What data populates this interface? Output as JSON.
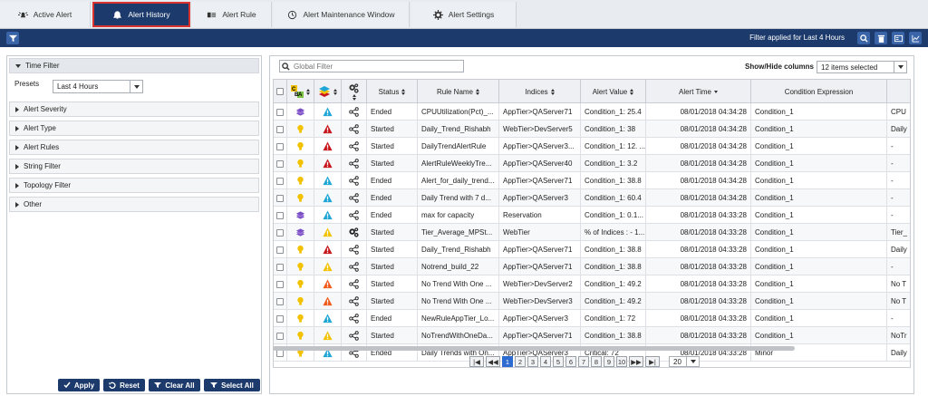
{
  "tabs": [
    {
      "label": "Active Alert",
      "icon": "alarm-icon"
    },
    {
      "label": "Alert History",
      "icon": "bell-icon"
    },
    {
      "label": "Alert Rule",
      "icon": "rule-list-icon"
    },
    {
      "label": "Alert Maintenance Window",
      "icon": "clock-settings-icon"
    },
    {
      "label": "Alert Settings",
      "icon": "gear-icon"
    }
  ],
  "toolbar": {
    "filter_applied": "Filter applied for Last 4 Hours"
  },
  "left_panel": {
    "time_filter": "Time Filter",
    "presets_label": "Presets",
    "presets_value": "Last 4 Hours",
    "sections": [
      "Alert Severity",
      "Alert Type",
      "Alert Rules",
      "String Filter",
      "Topology Filter",
      "Other"
    ],
    "buttons": {
      "apply": "Apply",
      "reset": "Reset",
      "clear_all": "Clear All",
      "select_all": "Select All"
    }
  },
  "grid": {
    "search_placeholder": "Global Filter",
    "show_hide_label": "Show/Hide columns",
    "show_hide_value": "12 items selected",
    "columns": [
      "Status",
      "Rule Name",
      "Indices",
      "Alert Value",
      "Alert Time",
      "Condition Expression"
    ],
    "rows": [
      {
        "sev": "purple",
        "type": "cyan",
        "kind": "share",
        "status": "Ended",
        "rule": "CPUUtilization(Pct)_...",
        "indices": "AppTier>QAServer71",
        "value": "Condition_1: 25.4",
        "time": "08/01/2018 04:34:28",
        "cond": "Condition_1",
        "extra": "CPU"
      },
      {
        "sev": "yellow",
        "type": "red",
        "kind": "share",
        "status": "Started",
        "rule": "Daily_Trend_Rishabh",
        "indices": "WebTier>DevServer5",
        "value": "Condition_1: 38",
        "time": "08/01/2018 04:34:28",
        "cond": "Condition_1",
        "extra": "Daily"
      },
      {
        "sev": "yellow",
        "type": "red",
        "kind": "share",
        "status": "Started",
        "rule": "DailyTrendAlertRule",
        "indices": "AppTier>QAServer3...",
        "value": "Condition_1: 12. ...",
        "time": "08/01/2018 04:34:28",
        "cond": "Condition_1",
        "extra": "-"
      },
      {
        "sev": "yellow",
        "type": "red",
        "kind": "share",
        "status": "Started",
        "rule": "AlertRuleWeeklyTre...",
        "indices": "AppTier>QAServer40",
        "value": "Condition_1: 3.2",
        "time": "08/01/2018 04:34:28",
        "cond": "Condition_1",
        "extra": "-"
      },
      {
        "sev": "yellow",
        "type": "cyan",
        "kind": "share",
        "status": "Ended",
        "rule": "Alert_for_daily_trend...",
        "indices": "AppTier>QAServer71",
        "value": "Condition_1: 38.8",
        "time": "08/01/2018 04:34:28",
        "cond": "Condition_1",
        "extra": "-"
      },
      {
        "sev": "yellow",
        "type": "cyan",
        "kind": "share",
        "status": "Ended",
        "rule": "Daily Trend with 7 d...",
        "indices": "AppTier>QAServer3",
        "value": "Condition_1: 60.4",
        "time": "08/01/2018 04:34:28",
        "cond": "Condition_1",
        "extra": "-"
      },
      {
        "sev": "purple",
        "type": "cyan",
        "kind": "share",
        "status": "Ended",
        "rule": "max for capacity",
        "indices": "Reservation",
        "value": "Condition_1: 0.1...",
        "time": "08/01/2018 04:33:28",
        "cond": "Condition_1",
        "extra": "-"
      },
      {
        "sev": "purple",
        "type": "yellow",
        "kind": "gears",
        "status": "Started",
        "rule": "Tier_Average_MPSt...",
        "indices": "WebTier",
        "value": "% of Indices : - 1...",
        "time": "08/01/2018 04:33:28",
        "cond": "Condition_1",
        "extra": "Tier_"
      },
      {
        "sev": "yellow",
        "type": "red",
        "kind": "share",
        "status": "Started",
        "rule": "Daily_Trend_Rishabh",
        "indices": "AppTier>QAServer71",
        "value": "Condition_1: 38.8",
        "time": "08/01/2018 04:33:28",
        "cond": "Condition_1",
        "extra": "Daily"
      },
      {
        "sev": "yellow",
        "type": "yellow",
        "kind": "share",
        "status": "Started",
        "rule": "Notrend_build_22",
        "indices": "AppTier>QAServer71",
        "value": "Condition_1: 38.8",
        "time": "08/01/2018 04:33:28",
        "cond": "Condition_1",
        "extra": "-"
      },
      {
        "sev": "yellow",
        "type": "orange",
        "kind": "share",
        "status": "Started",
        "rule": "No Trend With One ...",
        "indices": "WebTier>DevServer2",
        "value": "Condition_1: 49.2",
        "time": "08/01/2018 04:33:28",
        "cond": "Condition_1",
        "extra": "No T"
      },
      {
        "sev": "yellow",
        "type": "orange",
        "kind": "share",
        "status": "Started",
        "rule": "No Trend With One ...",
        "indices": "WebTier>DevServer3",
        "value": "Condition_1: 49.2",
        "time": "08/01/2018 04:33:28",
        "cond": "Condition_1",
        "extra": "No T"
      },
      {
        "sev": "yellow",
        "type": "cyan",
        "kind": "share",
        "status": "Ended",
        "rule": "NewRuleAppTier_Lo...",
        "indices": "AppTier>QAServer3",
        "value": "Condition_1: 72",
        "time": "08/01/2018 04:33:28",
        "cond": "Condition_1",
        "extra": "-"
      },
      {
        "sev": "yellow",
        "type": "yellow",
        "kind": "share",
        "status": "Started",
        "rule": "NoTrendWithOneDa...",
        "indices": "AppTier>QAServer71",
        "value": "Condition_1: 38.8",
        "time": "08/01/2018 04:33:28",
        "cond": "Condition_1",
        "extra": "NoTr"
      },
      {
        "sev": "yellow",
        "type": "cyan",
        "kind": "share",
        "status": "Ended",
        "rule": "Daily Trends with On...",
        "indices": "AppTier>QAServer3",
        "value": "Critical: 72",
        "time": "08/01/2018 04:33:28",
        "cond": "Minor",
        "extra": "Daily"
      }
    ]
  },
  "pager": {
    "pages": [
      "1",
      "2",
      "3",
      "4",
      "5",
      "6",
      "7",
      "8",
      "9",
      "10"
    ],
    "page_size": "20"
  },
  "colors": {
    "navy": "#1c3a6b",
    "purple": "#7b4fc4",
    "yellow": "#f2c200",
    "red": "#c8161d",
    "cyan": "#1ea5d6",
    "orange": "#f05a1a"
  }
}
